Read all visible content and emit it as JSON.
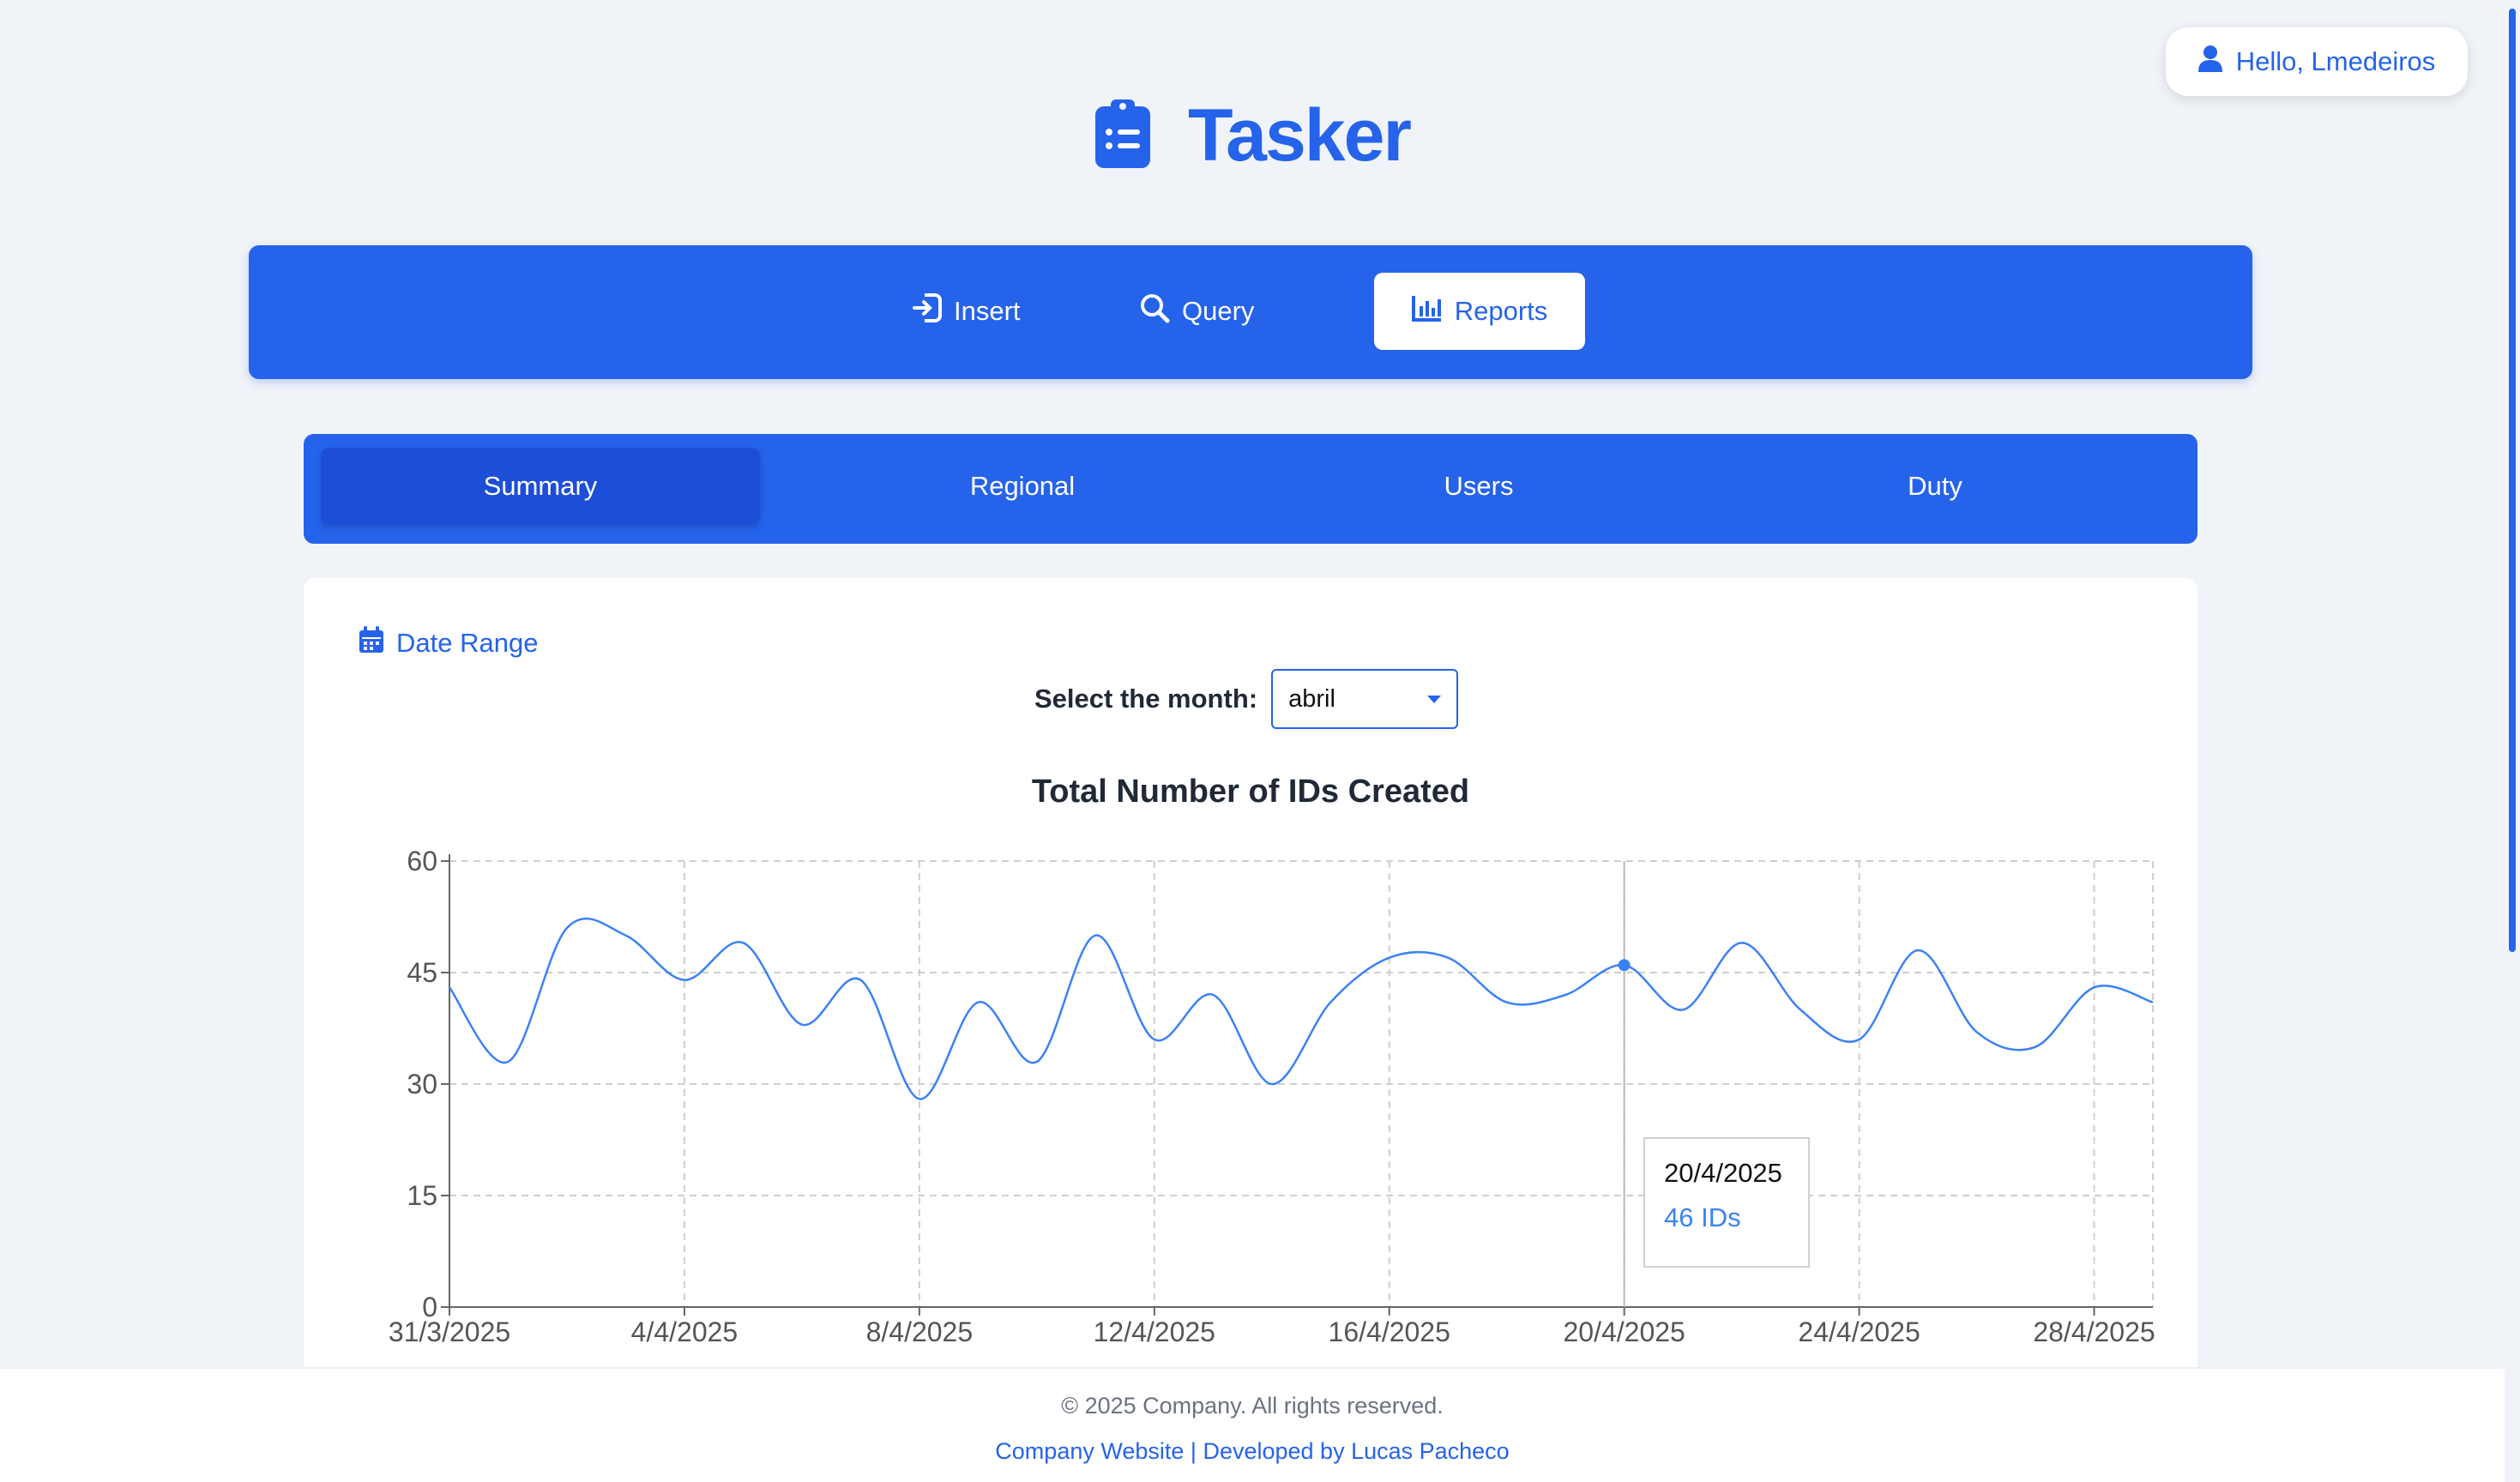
{
  "header": {
    "user_greeting": "Hello, Lmedeiros",
    "app_name": "Tasker"
  },
  "main_nav": {
    "items": [
      {
        "label": "Insert",
        "icon": "sign-in-icon"
      },
      {
        "label": "Query",
        "icon": "search-icon"
      },
      {
        "label": "Reports",
        "icon": "bar-chart-icon",
        "active": true
      }
    ]
  },
  "sub_tabs": {
    "items": [
      {
        "label": "Summary",
        "active": true
      },
      {
        "label": "Regional"
      },
      {
        "label": "Users"
      },
      {
        "label": "Duty"
      }
    ]
  },
  "filters": {
    "date_range_label": "Date Range",
    "month_label": "Select the month:",
    "month_value": "abril"
  },
  "chart_data": {
    "type": "line",
    "title": "Total Number of IDs Created",
    "x": [
      "31/3/2025",
      "1/4/2025",
      "2/4/2025",
      "3/4/2025",
      "4/4/2025",
      "5/4/2025",
      "6/4/2025",
      "7/4/2025",
      "8/4/2025",
      "9/4/2025",
      "10/4/2025",
      "11/4/2025",
      "12/4/2025",
      "13/4/2025",
      "14/4/2025",
      "15/4/2025",
      "16/4/2025",
      "17/4/2025",
      "18/4/2025",
      "19/4/2025",
      "20/4/2025",
      "21/4/2025",
      "22/4/2025",
      "23/4/2025",
      "24/4/2025",
      "25/4/2025",
      "26/4/2025",
      "27/4/2025",
      "28/4/2025",
      "29/4/2025"
    ],
    "values": [
      43,
      33,
      51,
      50,
      44,
      49,
      38,
      44,
      28,
      41,
      33,
      50,
      36,
      42,
      30,
      41,
      47,
      47,
      41,
      42,
      46,
      40,
      49,
      40,
      36,
      48,
      37,
      35,
      43,
      41
    ],
    "x_ticks": [
      "31/3/2025",
      "4/4/2025",
      "8/4/2025",
      "12/4/2025",
      "16/4/2025",
      "20/4/2025",
      "24/4/2025",
      "28/4/2025"
    ],
    "y_ticks": [
      0,
      15,
      30,
      45,
      60
    ],
    "ylim": [
      0,
      60
    ],
    "grid": true,
    "line_color": "#3b82f6",
    "highlight_index": 20
  },
  "tooltip": {
    "date": "20/4/2025",
    "value": "46 IDs"
  },
  "footer": {
    "copyright": "© 2025 Company. All rights reserved.",
    "company_link": "Company Website",
    "separator": "|",
    "dev_link": "Developed by Lucas Pacheco"
  },
  "colors": {
    "primary": "#2563eb",
    "background": "#f0f3f8"
  }
}
